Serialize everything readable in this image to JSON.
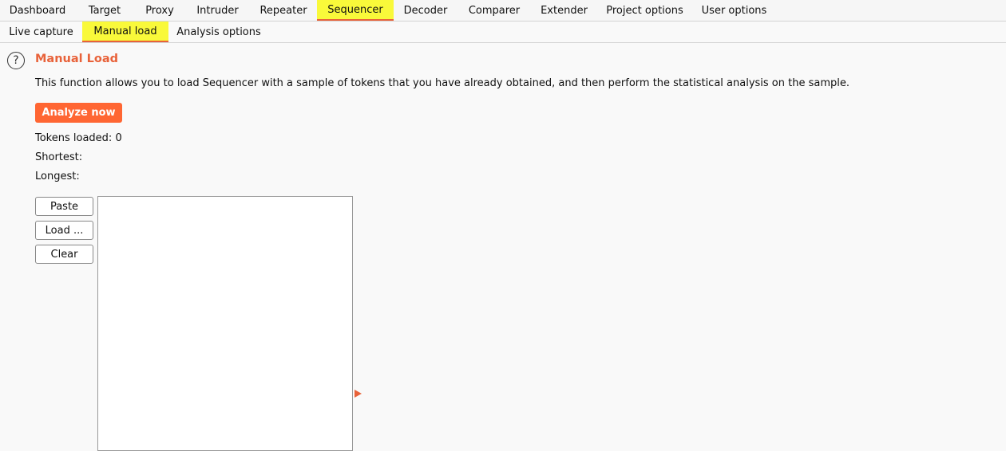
{
  "top_tabs": [
    {
      "label": "Dashboard",
      "active": false
    },
    {
      "label": "Target",
      "active": false
    },
    {
      "label": "Proxy",
      "active": false
    },
    {
      "label": "Intruder",
      "active": false
    },
    {
      "label": "Repeater",
      "active": false
    },
    {
      "label": "Sequencer",
      "active": true
    },
    {
      "label": "Decoder",
      "active": false
    },
    {
      "label": "Comparer",
      "active": false
    },
    {
      "label": "Extender",
      "active": false
    },
    {
      "label": "Project options",
      "active": false
    },
    {
      "label": "User options",
      "active": false
    }
  ],
  "sub_tabs": [
    {
      "label": "Live capture",
      "active": false
    },
    {
      "label": "Manual load",
      "active": true
    },
    {
      "label": "Analysis options",
      "active": false
    }
  ],
  "help_icon": {
    "glyph": "?",
    "icon": "help-circle-icon"
  },
  "panel": {
    "title": "Manual Load",
    "description": "This function allows you to load Sequencer with a sample of tokens that you have already obtained, and then perform the statistical analysis on the sample.",
    "analyze_label": "Analyze now",
    "tokens_loaded": "Tokens loaded: 0",
    "shortest": "Shortest:",
    "longest": "Longest:",
    "paste_label": "Paste",
    "load_label": "Load ...",
    "clear_label": "Clear",
    "tokens_value": ""
  },
  "colors": {
    "accent": "#e8623a",
    "button": "#ff6633",
    "active_tab": "#f9f93a"
  }
}
